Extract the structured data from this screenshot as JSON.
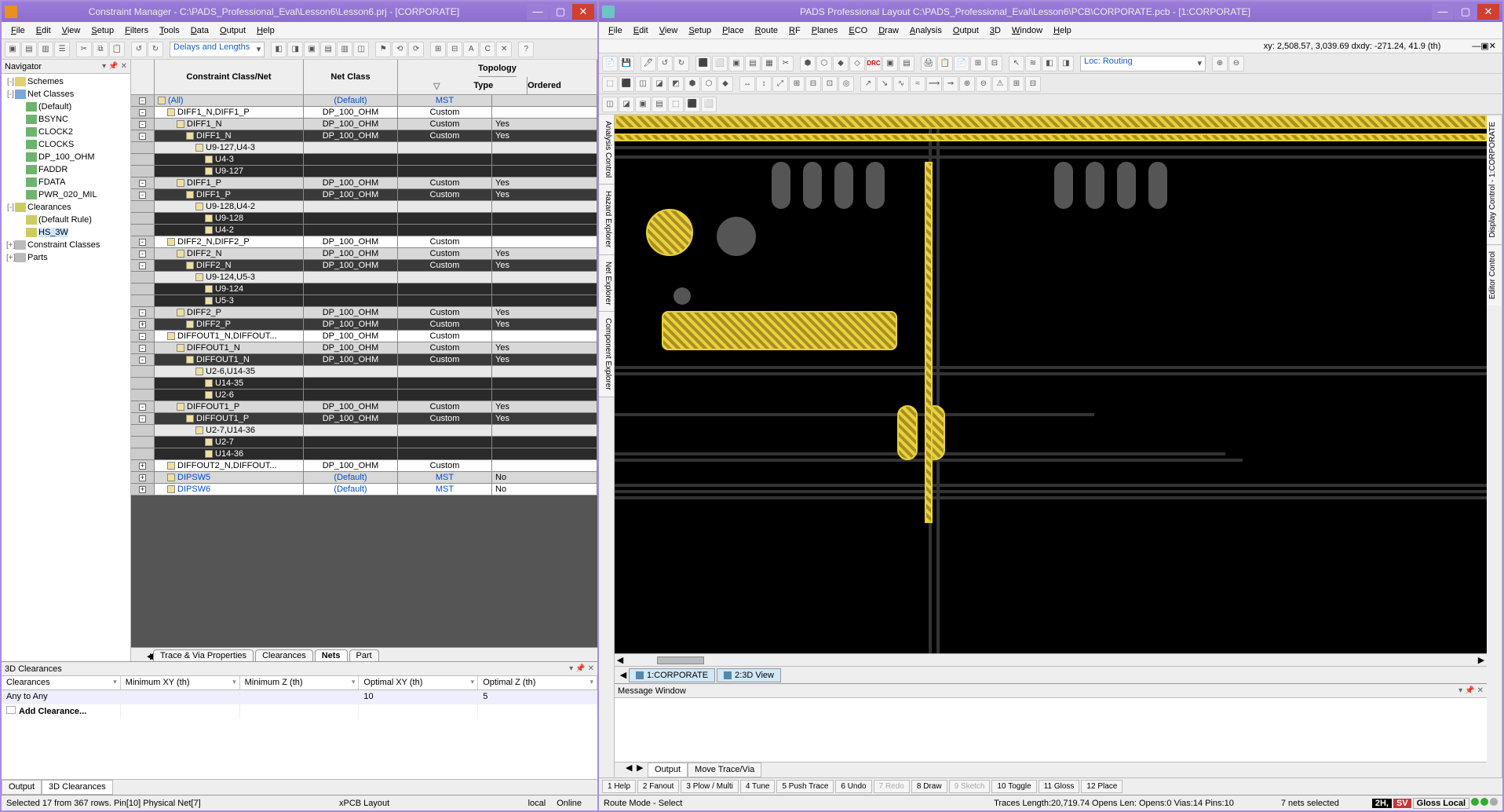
{
  "left": {
    "title": "Constraint Manager - C:\\PADS_Professional_Eval\\Lesson6\\Lesson6.prj - [CORPORATE]",
    "menus": [
      "File",
      "Edit",
      "View",
      "Setup",
      "Filters",
      "Tools",
      "Data",
      "Output",
      "Help"
    ],
    "toolbar_combo": "Delays and Lengths",
    "navigator": {
      "title": "Navigator",
      "root": [
        {
          "l": "Schemes",
          "d": 0,
          "ic": "ic-scheme",
          "tw": "-"
        },
        {
          "l": "Net Classes",
          "d": 0,
          "ic": "ic-net",
          "tw": "-"
        },
        {
          "l": "(Default)",
          "d": 1,
          "ic": "ic-green"
        },
        {
          "l": "BSYNC",
          "d": 1,
          "ic": "ic-green"
        },
        {
          "l": "CLOCK2",
          "d": 1,
          "ic": "ic-green"
        },
        {
          "l": "CLOCKS",
          "d": 1,
          "ic": "ic-green"
        },
        {
          "l": "DP_100_OHM",
          "d": 1,
          "ic": "ic-green"
        },
        {
          "l": "FADDR",
          "d": 1,
          "ic": "ic-green"
        },
        {
          "l": "FDATA",
          "d": 1,
          "ic": "ic-green"
        },
        {
          "l": "PWR_020_MIL",
          "d": 1,
          "ic": "ic-green"
        },
        {
          "l": "Clearances",
          "d": 0,
          "ic": "ic-rule",
          "tw": "-"
        },
        {
          "l": "(Default Rule)",
          "d": 1,
          "ic": "ic-rule"
        },
        {
          "l": "HS_3W",
          "d": 1,
          "ic": "ic-rule",
          "sel": true
        },
        {
          "l": "Constraint Classes",
          "d": 0,
          "ic": "ic-grey",
          "tw": "+"
        },
        {
          "l": "Parts",
          "d": 0,
          "ic": "ic-grey",
          "tw": "+"
        }
      ]
    },
    "grid": {
      "headers": {
        "class_net": "Constraint Class/Net",
        "net_class": "Net Class",
        "topology": "Topology",
        "type": "Type",
        "ordered": "Ordered"
      },
      "rows": [
        {
          "d": 0,
          "tw": "-",
          "name": "(All)",
          "nc": "(Default)",
          "type": "MST",
          "ord": "",
          "blue": true,
          "shade": "grey"
        },
        {
          "d": 1,
          "tw": "-",
          "name": "DIFF1_N,DIFF1_P",
          "nc": "DP_100_OHM",
          "type": "Custom",
          "ord": "",
          "shade": ""
        },
        {
          "d": 2,
          "tw": "-",
          "name": "DIFF1_N",
          "nc": "DP_100_OHM",
          "type": "Custom",
          "ord": "Yes",
          "shade": "grey"
        },
        {
          "d": 3,
          "tw": "-",
          "name": "DIFF1_N",
          "nc": "DP_100_OHM",
          "type": "Custom",
          "ord": "Yes",
          "shade": "dark"
        },
        {
          "d": 4,
          "name": "U9-127,U4-3",
          "shade": "grey2"
        },
        {
          "d": 5,
          "name": "U4-3",
          "shade": "dark2"
        },
        {
          "d": 5,
          "name": "U9-127",
          "shade": "dark2"
        },
        {
          "d": 2,
          "tw": "-",
          "name": "DIFF1_P",
          "nc": "DP_100_OHM",
          "type": "Custom",
          "ord": "Yes",
          "shade": "grey"
        },
        {
          "d": 3,
          "tw": "-",
          "name": "DIFF1_P",
          "nc": "DP_100_OHM",
          "type": "Custom",
          "ord": "Yes",
          "shade": "dark"
        },
        {
          "d": 4,
          "name": "U9-128,U4-2",
          "shade": "grey2"
        },
        {
          "d": 5,
          "name": "U9-128",
          "shade": "dark2"
        },
        {
          "d": 5,
          "name": "U4-2",
          "shade": "dark2"
        },
        {
          "d": 1,
          "tw": "-",
          "name": "DIFF2_N,DIFF2_P",
          "nc": "DP_100_OHM",
          "type": "Custom",
          "ord": "",
          "shade": ""
        },
        {
          "d": 2,
          "tw": "-",
          "name": "DIFF2_N",
          "nc": "DP_100_OHM",
          "type": "Custom",
          "ord": "Yes",
          "shade": "grey"
        },
        {
          "d": 3,
          "tw": "-",
          "name": "DIFF2_N",
          "nc": "DP_100_OHM",
          "type": "Custom",
          "ord": "Yes",
          "shade": "dark"
        },
        {
          "d": 4,
          "name": "U9-124,U5-3",
          "shade": "grey2"
        },
        {
          "d": 5,
          "name": "U9-124",
          "shade": "dark2"
        },
        {
          "d": 5,
          "name": "U5-3",
          "shade": "dark2"
        },
        {
          "d": 2,
          "tw": "-",
          "name": "DIFF2_P",
          "nc": "DP_100_OHM",
          "type": "Custom",
          "ord": "Yes",
          "shade": "grey"
        },
        {
          "d": 3,
          "tw": "+",
          "name": "DIFF2_P",
          "nc": "DP_100_OHM",
          "type": "Custom",
          "ord": "Yes",
          "shade": "dark"
        },
        {
          "d": 1,
          "tw": "-",
          "name": "DIFFOUT1_N,DIFFOUT...",
          "nc": "DP_100_OHM",
          "type": "Custom",
          "ord": "",
          "shade": ""
        },
        {
          "d": 2,
          "tw": "-",
          "name": "DIFFOUT1_N",
          "nc": "DP_100_OHM",
          "type": "Custom",
          "ord": "Yes",
          "shade": "grey"
        },
        {
          "d": 3,
          "tw": "-",
          "name": "DIFFOUT1_N",
          "nc": "DP_100_OHM",
          "type": "Custom",
          "ord": "Yes",
          "shade": "dark"
        },
        {
          "d": 4,
          "name": "U2-6,U14-35",
          "shade": "grey2"
        },
        {
          "d": 5,
          "name": "U14-35",
          "shade": "dark2"
        },
        {
          "d": 5,
          "name": "U2-6",
          "shade": "dark2"
        },
        {
          "d": 2,
          "tw": "-",
          "name": "DIFFOUT1_P",
          "nc": "DP_100_OHM",
          "type": "Custom",
          "ord": "Yes",
          "shade": "grey"
        },
        {
          "d": 3,
          "tw": "-",
          "name": "DIFFOUT1_P",
          "nc": "DP_100_OHM",
          "type": "Custom",
          "ord": "Yes",
          "shade": "dark"
        },
        {
          "d": 4,
          "name": "U2-7,U14-36",
          "shade": "grey2"
        },
        {
          "d": 5,
          "name": "U2-7",
          "shade": "dark2"
        },
        {
          "d": 5,
          "name": "U14-36",
          "shade": "dark2"
        },
        {
          "d": 1,
          "tw": "+",
          "name": "DIFFOUT2_N,DIFFOUT...",
          "nc": "DP_100_OHM",
          "type": "Custom",
          "ord": "",
          "shade": ""
        },
        {
          "d": 1,
          "tw": "+",
          "name": "DIPSW5",
          "nc": "(Default)",
          "type": "MST",
          "ord": "No",
          "blue": true,
          "shade": "grey"
        },
        {
          "d": 1,
          "tw": "+",
          "name": "DIPSW6",
          "nc": "(Default)",
          "type": "MST",
          "ord": "No",
          "blue": true,
          "shade": ""
        }
      ]
    },
    "tabs": [
      "Trace & Via Properties",
      "Clearances",
      "Nets",
      "Part"
    ],
    "active_tab": 2,
    "clearances": {
      "title": "3D Clearances",
      "headers": [
        "Clearances",
        "Minimum XY (th)",
        "Minimum Z (th)",
        "Optimal XY (th)",
        "Optimal Z (th)"
      ],
      "row_any": {
        "label": "Any to Any",
        "min_xy": "",
        "min_z": "",
        "opt_xy": "10",
        "opt_z": "5"
      },
      "add": "Add Clearance..."
    },
    "out_tabs": [
      "Output",
      "3D Clearances"
    ],
    "out_active": 1,
    "status": {
      "sel": "Selected 17 from 367 rows. Pin[10] Physical Net[7]",
      "mid": "xPCB Layout",
      "mode1": "local",
      "mode2": "Online"
    }
  },
  "right": {
    "title": "PADS Professional Layout  C:\\PADS_Professional_Eval\\Lesson6\\PCB\\CORPORATE.pcb - [1:CORPORATE]",
    "menus": [
      "File",
      "Edit",
      "View",
      "Setup",
      "Place",
      "Route",
      "RF",
      "Planes",
      "ECO",
      "Draw",
      "Analysis",
      "Output",
      "3D",
      "Window",
      "Help"
    ],
    "coords": "xy: 2,508.57, 3,039.69  dxdy: -271.24, 41.9  (th)",
    "loc_combo": "Loc: Routing",
    "side_left": [
      "Analysis Control",
      "Hazard Explorer",
      "Net Explorer",
      "Component Explorer"
    ],
    "side_right": [
      "Display Control - 1:CORPORATE",
      "Editor Control"
    ],
    "view_tabs": [
      {
        "l": "1:CORPORATE"
      },
      {
        "l": "2:3D View"
      }
    ],
    "msg_title": "Message Window",
    "msg_tabs": [
      "Output",
      "Move Trace/Via"
    ],
    "fn": [
      "1 Help",
      "2 Fanout",
      "3 Plow / Multi",
      "4 Tune",
      "5 Push Trace",
      "6 Undo",
      "7 Redo",
      "8 Draw",
      "9 Sketch",
      "10 Toggle",
      "11 Gloss",
      "12 Place"
    ],
    "fn_disabled": [
      6,
      8
    ],
    "status": {
      "mode": "Route Mode - Select",
      "traces": "Traces Length:20,719.74 Opens Len:  Opens:0 Vias:14 Pins:10",
      "sel": "7  nets selected",
      "b1": "2H,",
      "b2": "SV",
      "b3": "Gloss Local"
    }
  }
}
